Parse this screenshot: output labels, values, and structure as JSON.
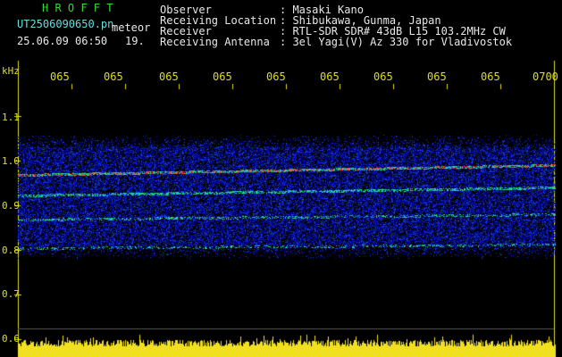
{
  "header": {
    "app_title": "H R O F F T",
    "filename": "UT2506090650.pn",
    "event_type": "meteor",
    "datetime": "25.06.09 06:50",
    "count": "19.",
    "observer_label": "Observer",
    "observer_value": ": Masaki Kano",
    "location_label": "Receiving Location",
    "location_value": ": Shibukawa, Gunma, Japan",
    "receiver_label": "Receiver",
    "receiver_value": ": RTL-SDR SDR# 43dB L15 103.2MHz CW",
    "antenna_label": "Receiving Antenna",
    "antenna_value": ": 3el Yagi(V) Az 330 for Vladivostok"
  },
  "axis": {
    "unit_label": "kHz",
    "y_ticks": [
      "1.1",
      "1.0",
      "0.9",
      "0.8",
      "0.7",
      "0.6"
    ],
    "x_ticks": [
      "065",
      "065",
      "065",
      "065",
      "065",
      "065",
      "065",
      "065",
      "065",
      "0700"
    ]
  },
  "colors": {
    "background": "#000000",
    "noise_blue": "#1030c0",
    "signal_green": "#20e060",
    "signal_red": "#ff2020",
    "bar_yellow": "#f0e020"
  }
}
